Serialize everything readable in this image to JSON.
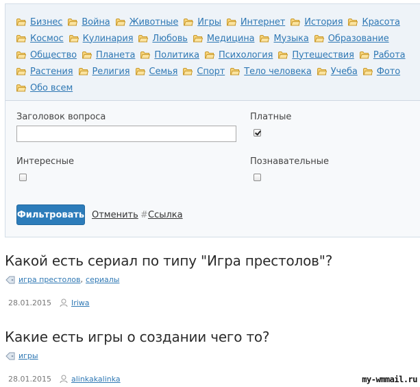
{
  "categories": [
    "Бизнес",
    "Война",
    "Животные",
    "Игры",
    "Интернет",
    "История",
    "Красота",
    "Космос",
    "Кулинария",
    "Любовь",
    "Медицина",
    "Музыка",
    "Образование",
    "Общество",
    "Планета",
    "Политика",
    "Психология",
    "Путешествия",
    "Работа",
    "Растения",
    "Религия",
    "Семья",
    "Спорт",
    "Тело человека",
    "Учеба",
    "Фото",
    "Обо всем"
  ],
  "filter": {
    "title_label": "Заголовок вопроса",
    "title_value": "",
    "paid_label": "Платные",
    "paid_checked": true,
    "interesting_label": "Интересные",
    "interesting_checked": false,
    "educational_label": "Познавательные",
    "educational_checked": false,
    "submit_label": "Фильтровать",
    "cancel_label": "Отменить",
    "link_hash": "#",
    "link_label": "Ссылка"
  },
  "questions": [
    {
      "title": "Какой есть сериал по типу \"Игра престолов\"?",
      "tags": [
        "игра престолов",
        "сериалы"
      ],
      "date": "28.01.2015",
      "author": "Iriwa"
    },
    {
      "title": "Какие есть игры о создании чего то?",
      "tags": [
        "игры"
      ],
      "date": "28.01.2015",
      "author": "alinkakalinka"
    }
  ],
  "watermark": "my-wmmail.ru",
  "colors": {
    "link": "#2f78b4",
    "button": "#2c7cba",
    "panel": "#eef3f8"
  }
}
